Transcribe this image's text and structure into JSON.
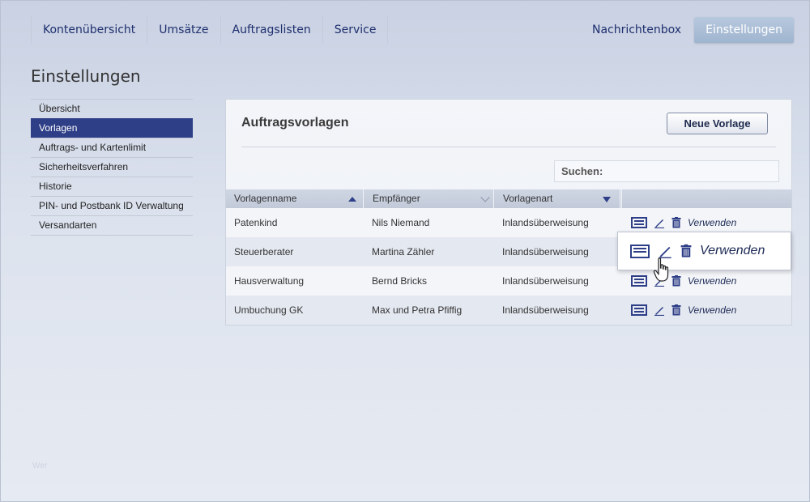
{
  "nav": {
    "left": [
      "Kontenübersicht",
      "Umsätze",
      "Auftragslisten",
      "Service"
    ],
    "messages": "Nachrichtenbox",
    "settings": "Einstellungen"
  },
  "page_title": "Einstellungen",
  "sidebar": {
    "items": [
      {
        "label": "Übersicht"
      },
      {
        "label": "Vorlagen"
      },
      {
        "label": "Auftrags- und Kartenlimit"
      },
      {
        "label": "Sicherheitsverfahren"
      },
      {
        "label": "Historie"
      },
      {
        "label": "PIN- und Postbank ID Verwaltung"
      },
      {
        "label": "Versandarten"
      }
    ],
    "active_index": 1
  },
  "panel": {
    "title": "Auftragsvorlagen",
    "new_button": "Neue Vorlage",
    "search_placeholder": "Suchen:"
  },
  "table": {
    "headers": [
      "Vorlagenname",
      "Empfänger",
      "Vorlagenart"
    ],
    "use_label": "Verwenden",
    "rows": [
      {
        "name": "Patenkind",
        "recipient": "Nils Niemand",
        "type": "Inlandsüberweisung"
      },
      {
        "name": "Steuerberater",
        "recipient": "Martina Zähler",
        "type": "Inlandsüberweisung"
      },
      {
        "name": "Hausverwaltung",
        "recipient": "Bernd Bricks",
        "type": "Inlandsüberweisung"
      },
      {
        "name": "Umbuchung GK",
        "recipient": "Max und Petra Pfiffig",
        "type": "Inlandsüberweisung"
      }
    ]
  },
  "popup": {
    "use_label": "Verwenden"
  },
  "footer": {
    "text": "Wer"
  },
  "colors": {
    "accent": "#2e3f87",
    "nav_text": "#1e2f6e"
  }
}
